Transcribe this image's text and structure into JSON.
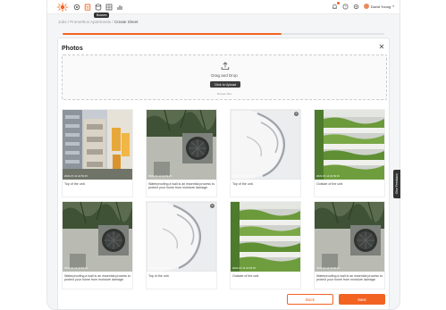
{
  "topbar": {
    "tooltip": "Bosses",
    "user_name": "David Young",
    "nav_icons": [
      "gear-icon",
      "clipboard-icon",
      "database-icon",
      "grid-icon",
      "chart-icon"
    ],
    "accent": "#f26322"
  },
  "breadcrumb": {
    "parts": [
      "Jobs",
      "Promethus Apartments"
    ],
    "separator": " / ",
    "current": "Create Sheet"
  },
  "progress": {
    "fraction": 0.68
  },
  "modal": {
    "title": "Photos",
    "close_icon": "close-icon",
    "dropzone": {
      "drag_text": "Drag and Drop",
      "upload_label": "Click to Upload",
      "browse_hint": "Browse files"
    }
  },
  "photos": [
    {
      "kind": "buildings",
      "timestamp": "2023-07-14 10:53:15",
      "caption": "Top of the unit.",
      "removable": false
    },
    {
      "kind": "ac",
      "timestamp": "2023-07-14 10:53:15",
      "caption": "Waterproofing a wall is an essential process to protect your home from moisture damage.",
      "removable": false
    },
    {
      "kind": "curve",
      "timestamp": "2023-07-14 10:53:15",
      "caption": "Top of the unit.",
      "removable": true
    },
    {
      "kind": "green",
      "timestamp": "2023-07-14 10:53:15",
      "caption": "Outside of the unit.",
      "removable": false
    },
    {
      "kind": "ac",
      "timestamp": "2023-07-14 10:53:15",
      "caption": "Waterproofing a wall is an essential process to protect your home from moisture damage.",
      "removable": false
    },
    {
      "kind": "curve",
      "timestamp": "2023-07-14 10:53:15",
      "caption": "Top of the unit.",
      "removable": true
    },
    {
      "kind": "green",
      "timestamp": "2023-07-14 10:53:15",
      "caption": "Outside of the unit.",
      "removable": false
    },
    {
      "kind": "ac",
      "timestamp": "2023-07-14 10:53:15",
      "caption": "Waterproofing a wall is an essential process to protect your home from moisture damage.",
      "removable": false
    }
  ],
  "buttons": {
    "back": "Back",
    "next": "Next"
  },
  "feedback_tab": "Give Feedback"
}
